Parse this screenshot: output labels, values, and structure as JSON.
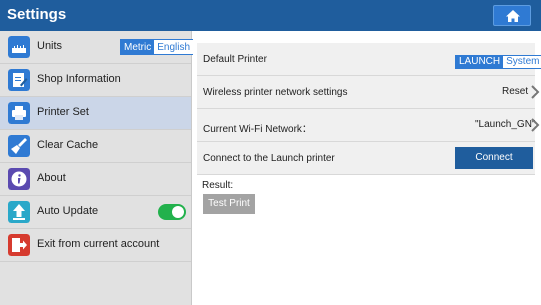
{
  "header": {
    "title": "Settings",
    "home_icon": "home-icon"
  },
  "sidebar": {
    "items": [
      {
        "label": "Units",
        "icon": "ruler-icon"
      },
      {
        "label": "Shop Information",
        "icon": "edit-document-icon"
      },
      {
        "label": "Printer Set",
        "icon": "printer-icon",
        "selected": true
      },
      {
        "label": "Clear Cache",
        "icon": "broom-icon"
      },
      {
        "label": "About",
        "icon": "info-icon"
      },
      {
        "label": "Auto Update",
        "icon": "upload-arrow-icon",
        "toggle_on": true
      },
      {
        "label": "Exit from current account",
        "icon": "exit-icon"
      }
    ],
    "units_toggle": {
      "metric": "Metric",
      "english": "English",
      "selected": "Metric"
    }
  },
  "printer": {
    "default_printer": {
      "label": "Default Printer",
      "options": [
        "LAUNCH",
        "System"
      ],
      "selected": "LAUNCH"
    },
    "wireless": {
      "label": "Wireless printer network settings",
      "value": "Reset"
    },
    "wifi": {
      "label": "Current Wi-Fi Network：",
      "value": "\"Launch_GN\""
    },
    "connect": {
      "label": "Connect to the Launch printer",
      "button": "Connect"
    },
    "result_label": "Result:",
    "test_button": "Test Print"
  },
  "colors": {
    "header_bg": "#1f5d9d",
    "accent": "#2f7ad3",
    "toggle_on": "#22b14c",
    "selected_row": "#cbd6e8"
  }
}
